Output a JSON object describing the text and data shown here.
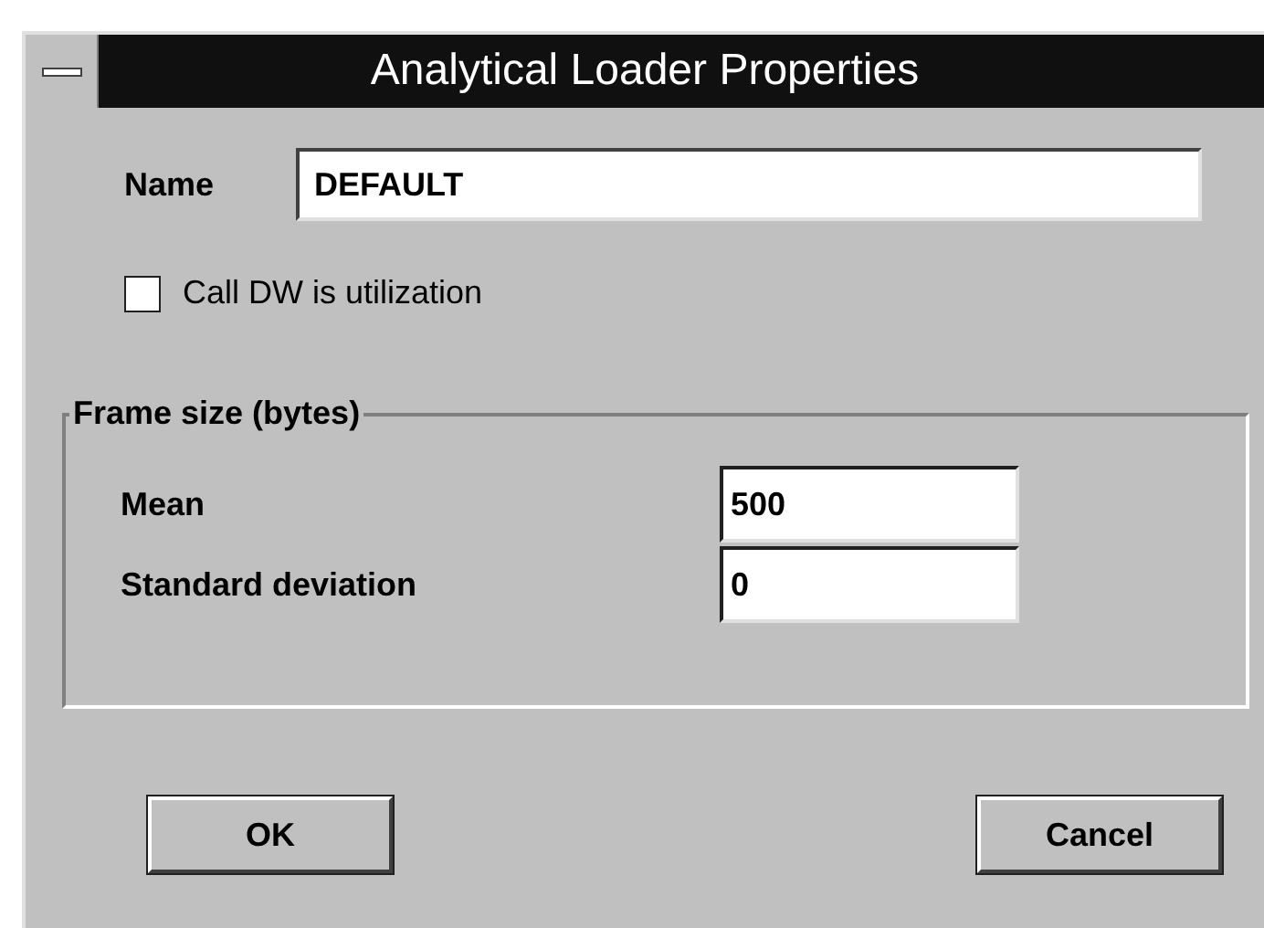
{
  "window": {
    "title": "Analytical Loader Properties"
  },
  "name_field": {
    "label": "Name",
    "value": "DEFAULT"
  },
  "checkbox": {
    "label": "Call DW is utilization",
    "checked": false
  },
  "group": {
    "title": "Frame size (bytes)",
    "fields": [
      {
        "label": "Mean",
        "value": "500"
      },
      {
        "label": "Standard deviation",
        "value": "0"
      }
    ]
  },
  "buttons": [
    "OK",
    "Cancel"
  ]
}
